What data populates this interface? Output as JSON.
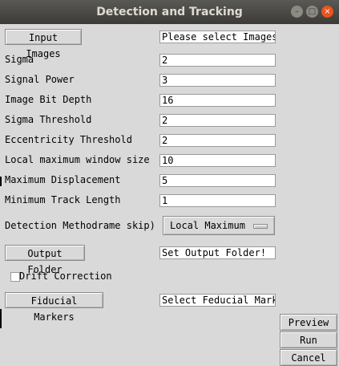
{
  "window": {
    "title": "Detection and Tracking",
    "min": "–",
    "max": "□",
    "close": "×"
  },
  "buttons": {
    "input_images": "Input Images",
    "output_folder": "Output Folder",
    "fiducial_markers": "Fiducial Markers",
    "preview": "Preview",
    "run": "Run",
    "cancel": "Cancel"
  },
  "fields": {
    "input_images": "Please select Images",
    "sigma": {
      "label": "Sigma",
      "value": "2"
    },
    "signal_power": {
      "label": "Signal Power",
      "value": "3"
    },
    "bit_depth": {
      "label": "Image Bit Depth",
      "value": "16"
    },
    "sigma_threshold": {
      "label": "Sigma Threshold",
      "value": "2"
    },
    "eccentricity": {
      "label": "Eccentricity Threshold",
      "value": "2"
    },
    "local_max_window": {
      "label": "Local maximum window size",
      "value": "10"
    },
    "max_displacement": {
      "label": "Maximum Displacement",
      "value": "5"
    },
    "min_track_length": {
      "label": "Minimum Track Length",
      "value": "1"
    },
    "output_folder": "Set Output Folder!",
    "fiducial": "Select Feducial Mark"
  },
  "detection": {
    "label": "Detection Methodrame skip)",
    "value": "Local Maximum"
  },
  "drift": {
    "label": "Drift Correction",
    "checked": false
  }
}
